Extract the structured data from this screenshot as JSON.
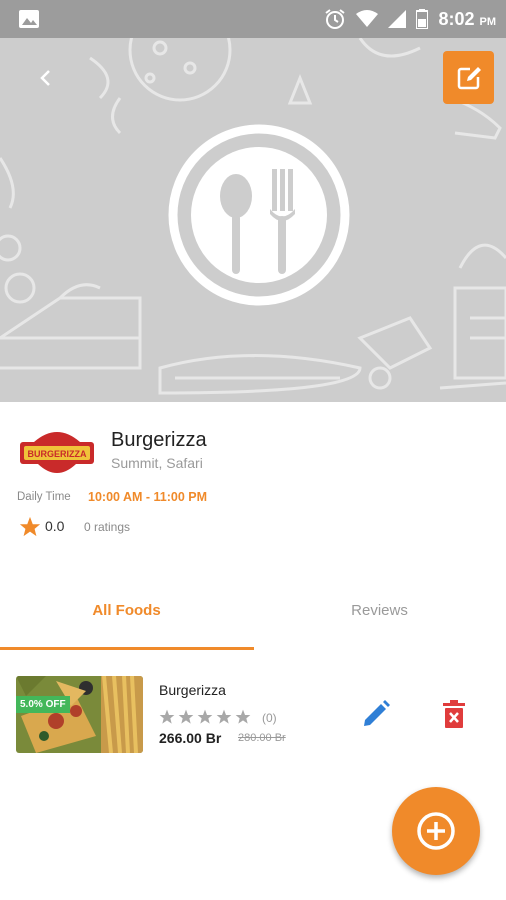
{
  "status_bar": {
    "time": "8:02",
    "ampm": "PM",
    "icons": [
      "gallery-icon",
      "alarm-icon",
      "wifi-icon",
      "signal-icon",
      "battery-icon"
    ]
  },
  "header": {
    "back_icon": "chevron-left-icon",
    "edit_icon": "edit-icon",
    "center_icon": "plate-spoon-fork-icon"
  },
  "restaurant": {
    "logo_text": "BURGERIZZA",
    "name": "Burgerizza",
    "location": "Summit, Safari",
    "daily_time_label": "Daily Time",
    "daily_time_value": "10:00 AM - 11:00 PM",
    "rating": "0.0",
    "ratings_count": "0 ratings"
  },
  "tabs": [
    {
      "label": "All Foods",
      "active": true
    },
    {
      "label": "Reviews",
      "active": false
    }
  ],
  "foods": [
    {
      "name": "Burgerizza",
      "badge": "5.0% OFF",
      "stars": 0,
      "star_max": 5,
      "reviews": "(0)",
      "price": "266.00 Br",
      "old_price": "280.00 Br"
    }
  ],
  "fab_icon": "add-circle-icon",
  "colors": {
    "accent": "#f08a2a",
    "badge": "#43b75a",
    "edit_blue": "#2f7fd6",
    "delete_red": "#e03c3c",
    "status_bar": "#9c9c9c",
    "header_bg": "#cdcdcd"
  }
}
